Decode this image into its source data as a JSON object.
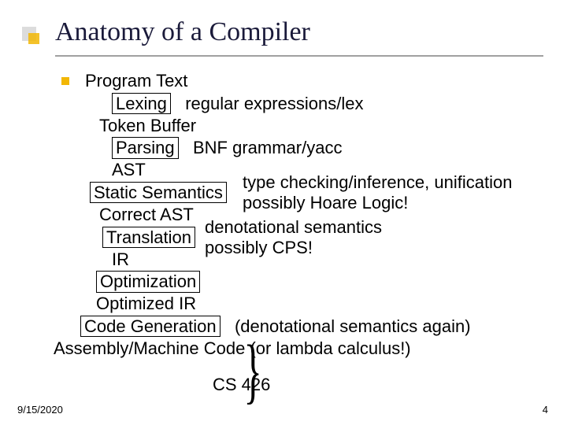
{
  "title": "Anatomy of a Compiler",
  "lines": {
    "program_text": "Program Text",
    "lexing": "Lexing",
    "lexing_note": "regular expressions/lex",
    "token_buffer": "Token Buffer",
    "parsing": "Parsing",
    "parsing_note": "BNF grammar/yacc",
    "ast": "AST",
    "static_semantics": "Static Semantics",
    "ss_note1": "type checking/inference, unification",
    "ss_note2": "possibly Hoare Logic!",
    "correct_ast": "Correct AST",
    "translation": "Translation",
    "tr_note1": "denotational semantics",
    "tr_note2": "possibly CPS!",
    "ir": "IR",
    "optimization": "Optimization",
    "optimized_ir": "Optimized IR",
    "code_gen": "Code Generation",
    "code_gen_note": "(denotational semantics again)",
    "asm": "Assembly/Machine Code (or lambda calculus!)",
    "brace_label": "CS 426"
  },
  "footer": {
    "date": "9/15/2020",
    "page": "4"
  }
}
